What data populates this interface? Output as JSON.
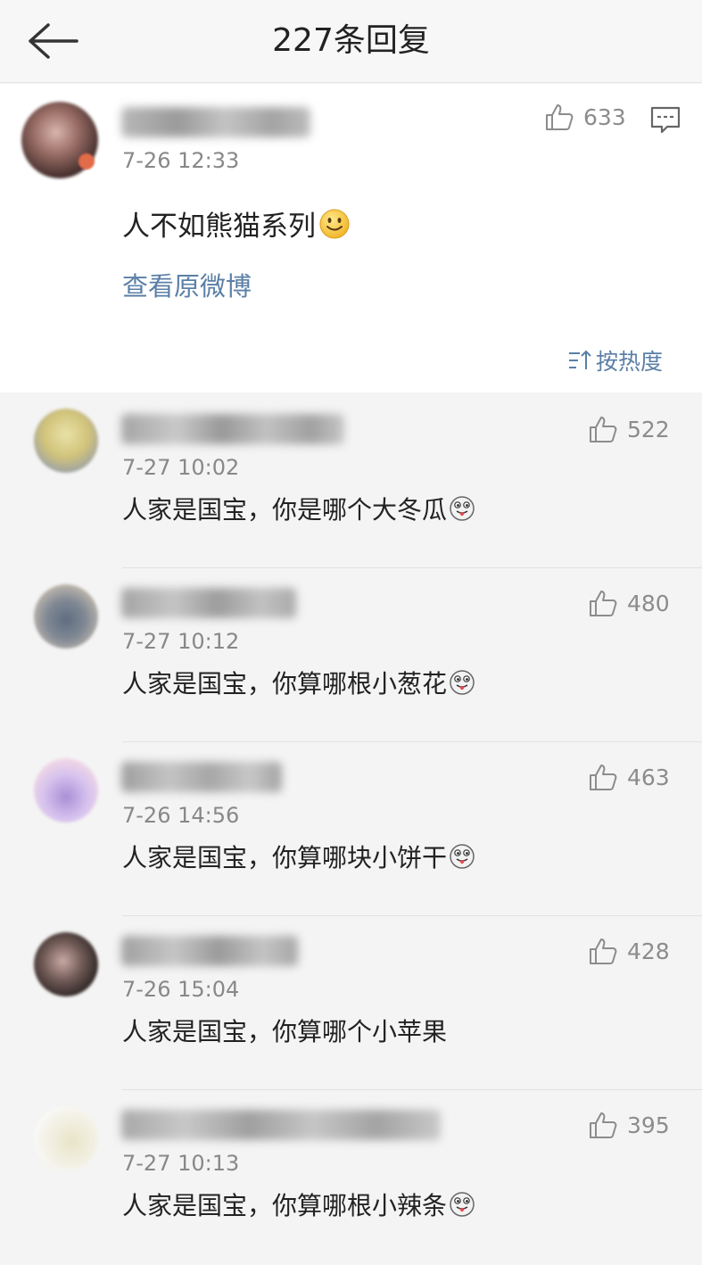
{
  "header": {
    "title": "227条回复"
  },
  "main_comment": {
    "time": "7-26 12:33",
    "like_count": "633",
    "text": "人不如熊猫系列",
    "view_original": "查看原微博"
  },
  "sort": {
    "label": "按热度"
  },
  "replies": [
    {
      "time": "7-27 10:02",
      "like_count": "522",
      "text": "人家是国宝，你是哪个大冬瓜",
      "has_emoji": true
    },
    {
      "time": "7-27 10:12",
      "like_count": "480",
      "text": "人家是国宝，你算哪根小葱花",
      "has_emoji": true
    },
    {
      "time": "7-26 14:56",
      "like_count": "463",
      "text": "人家是国宝，你算哪块小饼干",
      "has_emoji": true
    },
    {
      "time": "7-26 15:04",
      "like_count": "428",
      "text": "人家是国宝，你算哪个小苹果",
      "has_emoji": false
    },
    {
      "time": "7-27 10:13",
      "like_count": "395",
      "text": "人家是国宝，你算哪根小辣条",
      "has_emoji": true
    }
  ],
  "icons": {
    "back": "back-arrow-icon",
    "like": "thumbs-up-icon",
    "reply": "comment-bubble-icon",
    "sort": "sort-icon",
    "smile": "smile-emoji-icon",
    "tongue": "tongue-out-emoji-icon"
  },
  "colors": {
    "link": "#5b7fa6",
    "secondary_text": "#888888",
    "background": "#f4f4f4"
  }
}
